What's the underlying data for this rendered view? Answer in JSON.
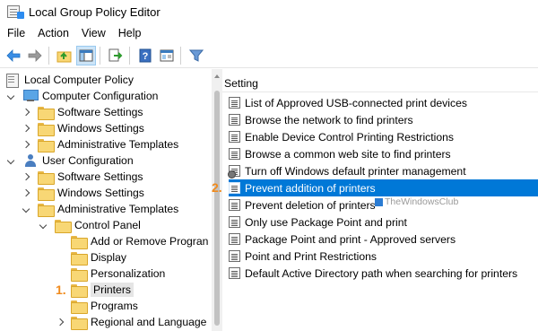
{
  "window": {
    "title": "Local Group Policy Editor"
  },
  "menu": [
    "File",
    "Action",
    "View",
    "Help"
  ],
  "toolbar": {
    "buttons": [
      "back-arrow-icon",
      "forward-arrow-icon",
      "up-folder-icon",
      "show-hide-tree-icon",
      "export-list-icon",
      "help-icon",
      "properties-icon",
      "filter-icon"
    ]
  },
  "tree": {
    "root": "Local Computer Policy",
    "computer_configuration": "Computer Configuration",
    "cc_software": "Software Settings",
    "cc_windows": "Windows Settings",
    "cc_admin": "Administrative Templates",
    "user_configuration": "User Configuration",
    "uc_software": "Software Settings",
    "uc_windows": "Windows Settings",
    "uc_admin": "Administrative Templates",
    "control_panel": "Control Panel",
    "add_remove": "Add or Remove Progran",
    "display": "Display",
    "personalization": "Personalization",
    "printers": "Printers",
    "programs": "Programs",
    "regional": "Regional and Language"
  },
  "markers": {
    "one": "1.",
    "two": "2."
  },
  "settings_header": "Setting",
  "settings": [
    "List of Approved USB-connected print devices",
    "Browse the network to find printers",
    "Enable Device Control Printing Restrictions",
    "Browse a common web site to find printers",
    "Turn off Windows default printer management",
    "Prevent addition of printers",
    "Prevent deletion of printers",
    "Only use Package Point and print",
    "Package Point and print - Approved servers",
    "Point and Print Restrictions",
    "Default Active Directory path when searching for printers"
  ],
  "watermark": "TheWindowsClub",
  "colors": {
    "selection": "#0078d7",
    "marker": "#f08a1c",
    "folder": "#f8d775"
  }
}
